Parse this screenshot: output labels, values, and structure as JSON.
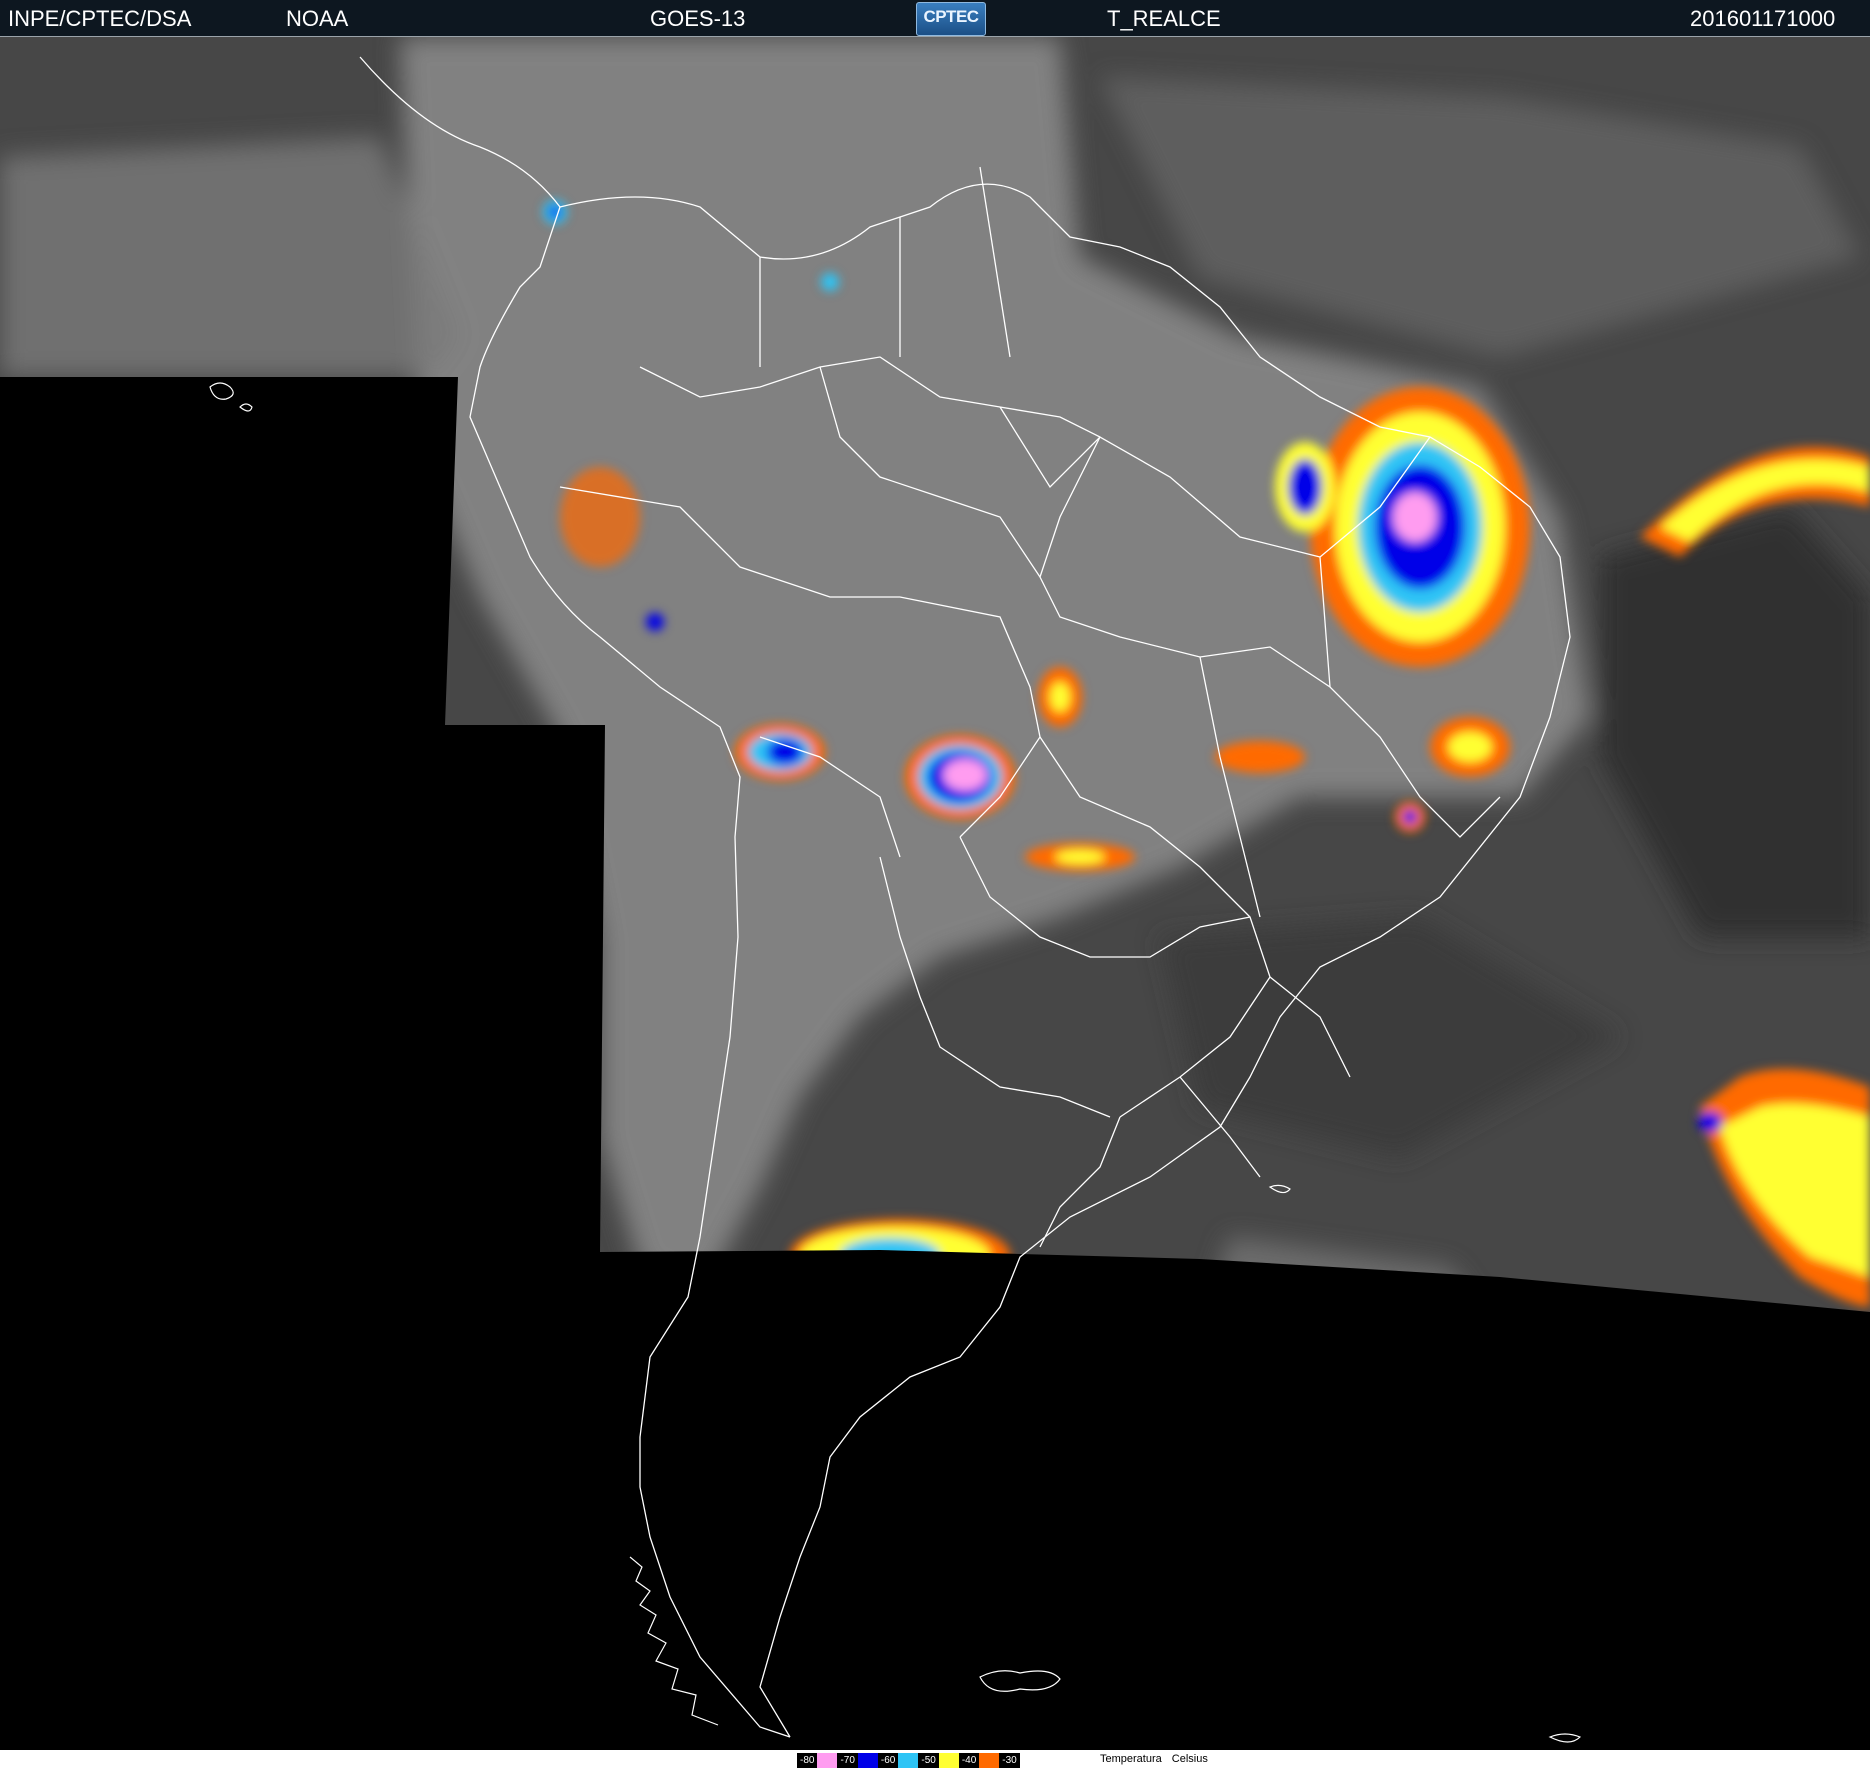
{
  "header": {
    "source": "INPE/CPTEC/DSA",
    "agency": "NOAA",
    "satellite": "GOES-13",
    "logo_text": "CPTEC",
    "product": "T_REALCE",
    "timestamp": "201601171000"
  },
  "legend": {
    "title": "Temperatura",
    "unit": "Celsius",
    "levels": [
      {
        "label": "-80",
        "color": "#ff9cf0"
      },
      {
        "label": "-70",
        "color": "#0000e8"
      },
      {
        "label": "-60",
        "color": "#2ec4f5"
      },
      {
        "label": "-50",
        "color": "#ffff33"
      },
      {
        "label": "-40",
        "color": "#ff6a00"
      },
      {
        "label": "-30",
        "color": ""
      }
    ]
  },
  "colors": {
    "ocean_cloud_gray": "#4a4a4a",
    "land_cloud_gray": "#8a8a8a",
    "no_data": "#000000",
    "borders": "#ffffff",
    "header_bg": "#0d1720"
  }
}
